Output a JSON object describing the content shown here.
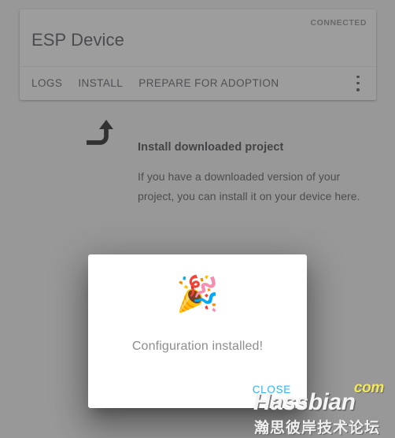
{
  "device_card": {
    "title": "ESP Device",
    "status": "CONNECTED",
    "tabs": [
      {
        "label": "LOGS"
      },
      {
        "label": "INSTALL"
      },
      {
        "label": "PREPARE FOR ADOPTION"
      }
    ],
    "overflow_icon": "more-vert-icon"
  },
  "install_section": {
    "icon": "turn-up-left-arrow-icon",
    "heading": "Install downloaded project",
    "body": "If you have a downloaded version of your project, you can install it on your device here."
  },
  "dialog": {
    "emoji": "🎉",
    "emoji_name": "party-popper-icon",
    "message": "Configuration installed!",
    "close_label": "CLOSE"
  },
  "watermark": {
    "suffix": "com",
    "name": "Hassbian",
    "subtitle": "瀚思彼岸技术论坛"
  },
  "colors": {
    "page_background": "#b0b0b0",
    "card_background": "#b9b9b9",
    "accent_link": "#29b6f6",
    "dialog_background": "#ffffff",
    "message_text": "#8d8d8d",
    "watermark_accent": "#f2e85a"
  }
}
